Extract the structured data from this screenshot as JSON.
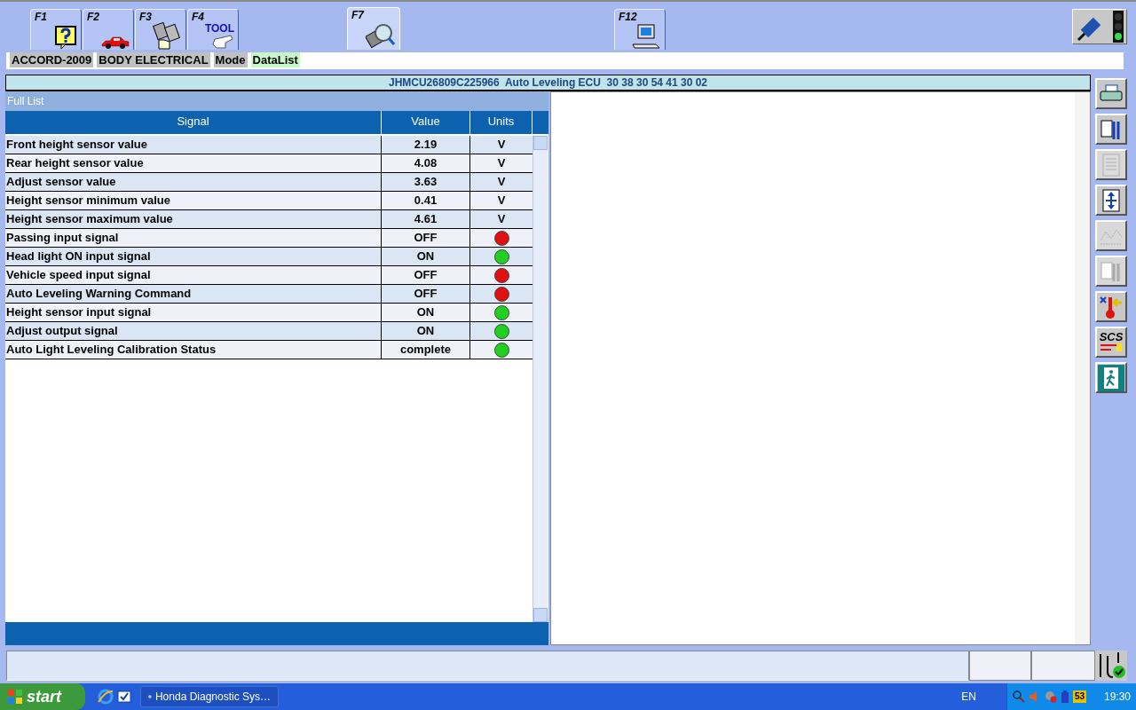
{
  "toolbar": {
    "tabs": [
      {
        "label": "F1",
        "kind": "help",
        "selected": false
      },
      {
        "label": "F2",
        "kind": "car",
        "selected": false
      },
      {
        "label": "F3",
        "kind": "module",
        "selected": false
      },
      {
        "label": "F4",
        "kind": "tool",
        "selected": false
      },
      {
        "label": "F7",
        "kind": "magnifier",
        "selected": true
      },
      {
        "label": "F12",
        "kind": "computer",
        "selected": false
      }
    ],
    "tool_badge": "TOOL"
  },
  "breadcrumb": [
    {
      "text": "ACCORD-2009",
      "kind": "grey"
    },
    {
      "text": "BODY ELECTRICAL",
      "kind": "grey"
    },
    {
      "text": "Mode",
      "kind": "grey"
    },
    {
      "text": "DataList",
      "kind": "green"
    }
  ],
  "ecu_header": "JHMCU26809C225966  Auto Leveling ECU  30 38 30 54 41 30 02",
  "list": {
    "title": "Full List",
    "columns": [
      "Signal",
      "Value",
      "Units"
    ],
    "rows": [
      {
        "signal": "Front height sensor value",
        "value": "2.19",
        "units": {
          "kind": "text",
          "text": "V"
        }
      },
      {
        "signal": "Rear height sensor value",
        "value": "4.08",
        "units": {
          "kind": "text",
          "text": "V"
        }
      },
      {
        "signal": "Adjust sensor value",
        "value": "3.63",
        "units": {
          "kind": "text",
          "text": "V"
        }
      },
      {
        "signal": "Height sensor minimum value",
        "value": "0.41",
        "units": {
          "kind": "text",
          "text": "V"
        }
      },
      {
        "signal": "Height sensor maximum value",
        "value": "4.61",
        "units": {
          "kind": "text",
          "text": "V"
        }
      },
      {
        "signal": "Passing input signal",
        "value": "OFF",
        "units": {
          "kind": "lamp",
          "color": "#e01010"
        }
      },
      {
        "signal": "Head light ON input signal",
        "value": "ON",
        "units": {
          "kind": "lamp",
          "color": "#20d020"
        }
      },
      {
        "signal": "Vehicle speed input signal",
        "value": "OFF",
        "units": {
          "kind": "lamp",
          "color": "#e01010"
        }
      },
      {
        "signal": "Auto Leveling Warning Command",
        "value": "OFF",
        "units": {
          "kind": "lamp",
          "color": "#e01010"
        }
      },
      {
        "signal": "Height sensor input signal",
        "value": "ON",
        "units": {
          "kind": "lamp",
          "color": "#20d020"
        }
      },
      {
        "signal": "Adjust output signal",
        "value": "ON",
        "units": {
          "kind": "lamp",
          "color": "#20d020"
        }
      },
      {
        "signal": "Auto Light Leveling Calibration Status",
        "value": "complete",
        "units": {
          "kind": "lamp",
          "color": "#20d020"
        }
      }
    ]
  },
  "side_buttons": [
    {
      "kind": "printer",
      "disabled": false
    },
    {
      "kind": "tools",
      "disabled": false
    },
    {
      "kind": "document",
      "disabled": true
    },
    {
      "kind": "updown",
      "disabled": false
    },
    {
      "kind": "graph",
      "disabled": true
    },
    {
      "kind": "tools",
      "disabled": true
    },
    {
      "kind": "thermometer",
      "disabled": false
    },
    {
      "kind": "scs",
      "disabled": false,
      "text": "SCS"
    },
    {
      "kind": "exit",
      "disabled": false
    }
  ],
  "taskbar": {
    "start": "start",
    "task": "Honda Diagnostic Sys…",
    "language": "EN",
    "time": "19:30",
    "tray_badge": "53"
  }
}
